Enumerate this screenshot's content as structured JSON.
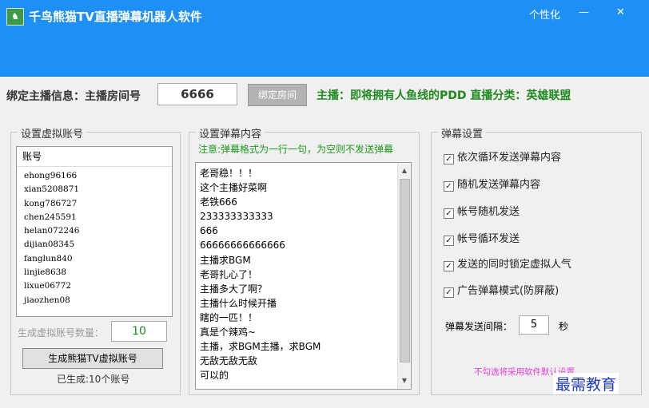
{
  "window": {
    "title": "千鸟熊猫TV直播弹幕机器人软件",
    "personalize": "个性化",
    "minimize": "—",
    "close": "✕"
  },
  "bind": {
    "label": "绑定主播信息：主播房间号",
    "room_value": "6666",
    "button": "绑定房间",
    "anchor_info": "主播：即将拥有人鱼线的PDD  直播分类：英雄联盟"
  },
  "accounts": {
    "group_title": "设置虚拟账号",
    "list_header": "账号",
    "items": [
      "ehong96166",
      "xian5208871",
      "kong786727",
      "chen245591",
      "helan072246",
      "dijian08345",
      "fanglun840",
      "linjie8638",
      "lixue06772",
      "jiaozhen08"
    ],
    "count_label": "生成虚拟账号数量：",
    "count_value": "10",
    "generate_button": "生成熊猫TV虚拟账号",
    "status": "已生成:10个账号"
  },
  "danmu": {
    "group_title": "设置弹幕内容",
    "note": "注意:弹幕格式为一行一句，为空则不发送弹幕",
    "lines": [
      "老哥稳！！！",
      "这个主播好菜啊",
      "老铁666",
      "233333333333",
      "666",
      "66666666666666",
      "主播求BGM",
      "老哥扎心了！",
      "主播多大了啊？",
      "主播什么时候开播",
      "瞎的一匹！！",
      "真是个辣鸡~",
      "主播，求BGM主播，求BGM",
      "无敌无敌无敌",
      "可以的"
    ]
  },
  "settings": {
    "group_title": "弹幕设置",
    "options": [
      {
        "label": "依次循环发送弹幕内容",
        "checked": true
      },
      {
        "label": "随机发送弹幕内容",
        "checked": true
      },
      {
        "label": "帐号随机发送",
        "checked": true
      },
      {
        "label": "帐号循环发送",
        "checked": true
      },
      {
        "label": "发送的同时锁定虚拟人气",
        "checked": true
      },
      {
        "label": "广告弹幕模式(防屏蔽)",
        "checked": true
      }
    ],
    "interval_label": "弹幕发送间隔：",
    "interval_value": "5",
    "interval_unit": "秒",
    "hint": "不勾选将采用软件默认设置"
  },
  "watermark": "最需教育"
}
